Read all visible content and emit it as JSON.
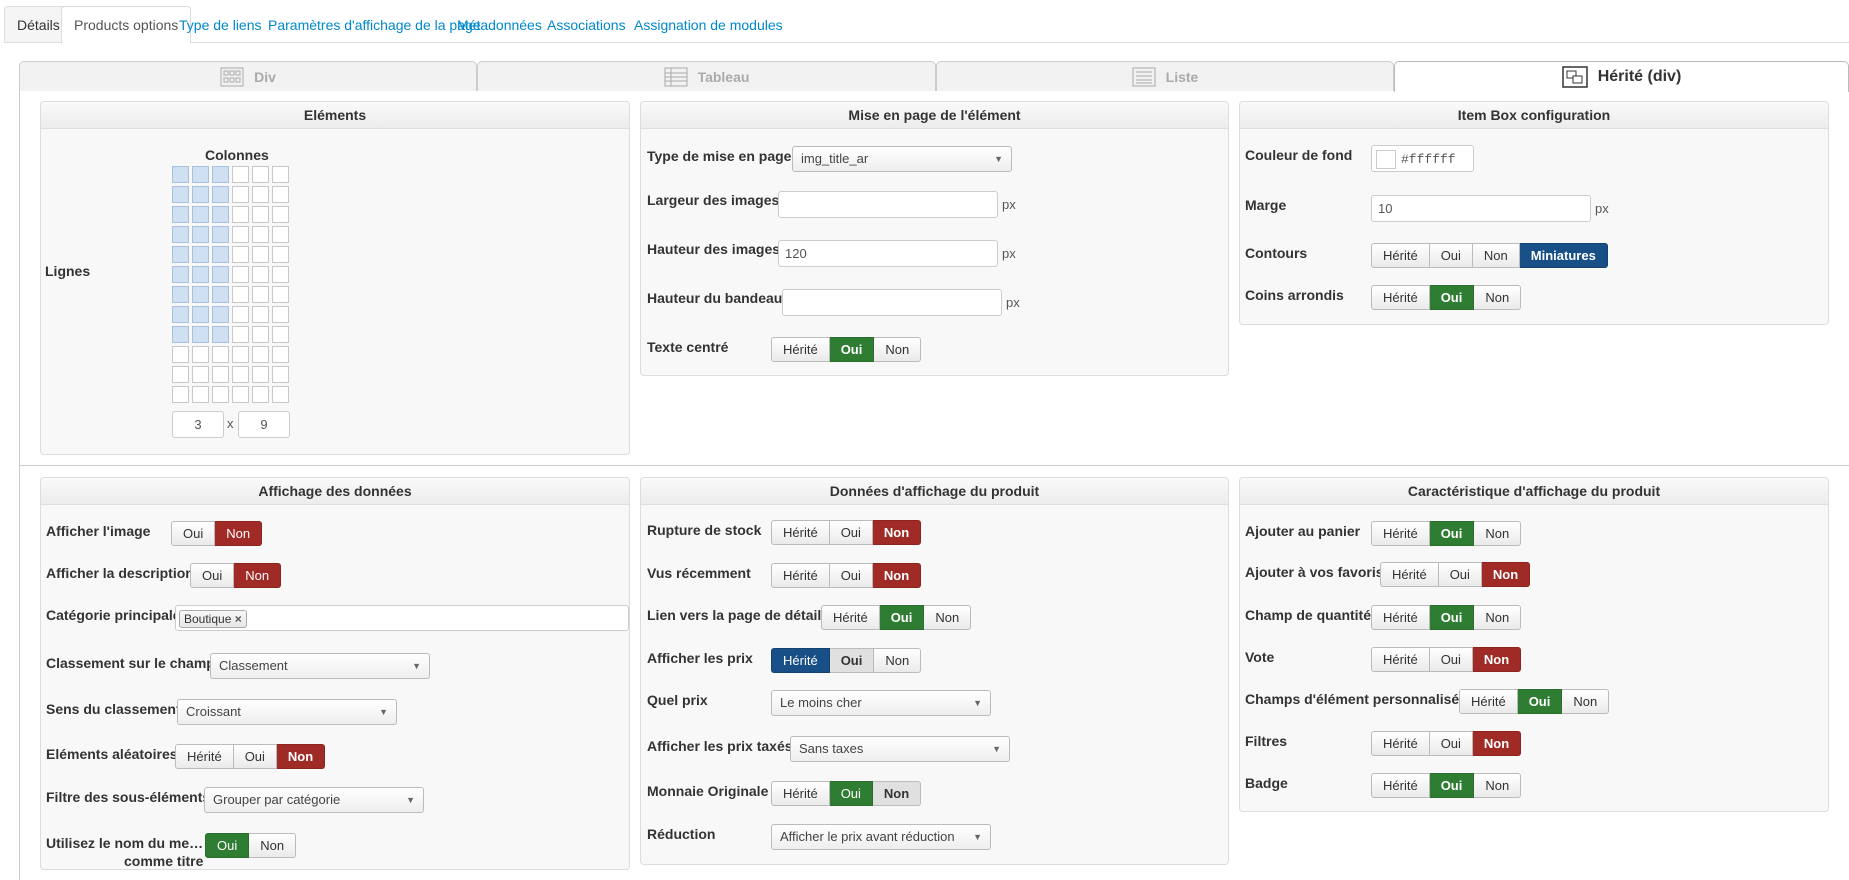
{
  "tabs": [
    "Détails",
    "Products options",
    "Type de liens",
    "Paramètres d'affichage de la page",
    "Métadonnées",
    "Associations",
    "Assignation de modules"
  ],
  "layouts": {
    "div": "Div",
    "tableau": "Tableau",
    "liste": "Liste",
    "herite": "Hérité (div)"
  },
  "elements": {
    "title": "Eléments",
    "colonnes": "Colonnes",
    "lignes": "Lignes",
    "cols": 3,
    "rows": 9,
    "grid_cols": 6,
    "grid_rows": 12,
    "cols_value": "3",
    "x": "x",
    "rows_value": "9"
  },
  "mise": {
    "title": "Mise en page de l'élément",
    "type_label": "Type de mise en page",
    "type_value": "img_title_ar",
    "largeur_label": "Largeur des images",
    "largeur_value": "",
    "hauteur_label": "Hauteur des images",
    "hauteur_value": "120",
    "bandeau_label": "Hauteur du bandeau",
    "bandeau_value": "",
    "centre_label": "Texte centré",
    "px": "px"
  },
  "itembox": {
    "title": "Item Box configuration",
    "couleur_label": "Couleur de fond",
    "couleur_value": "#ffffff",
    "marge_label": "Marge",
    "marge_value": "10",
    "contours_label": "Contours",
    "coins_label": "Coins arrondis"
  },
  "affichage": {
    "title": "Affichage des données",
    "image": "Afficher l'image",
    "description": "Afficher la description",
    "categorie": "Catégorie principale",
    "categorie_tag": "Boutique",
    "classement": "Classement sur le champ",
    "classement_value": "Classement",
    "sens": "Sens du classement",
    "sens_value": "Croissant",
    "aleatoires": "Eléments aléatoires",
    "filtre": "Filtre des sous-éléments",
    "filtre_value": "Grouper par catégorie",
    "nom_l1": "Utilisez le nom du me…",
    "nom_l2": "comme titre"
  },
  "donnees": {
    "title": "Données d'affichage du produit",
    "rupture": "Rupture de stock",
    "vus": "Vus récemment",
    "lien": "Lien vers la page de détail",
    "prix": "Afficher les prix",
    "quel": "Quel prix",
    "quel_value": "Le moins cher",
    "taxes": "Afficher les prix taxés",
    "taxes_value": "Sans taxes",
    "monnaie": "Monnaie Originale",
    "reduction": "Réduction",
    "reduction_value": "Afficher le prix avant réduction"
  },
  "caract": {
    "title": "Caractéristique d'affichage du produit",
    "panier": "Ajouter au panier",
    "favoris": "Ajouter à vos favoris",
    "quantite": "Champ de quantité",
    "vote": "Vote",
    "champs": "Champs d'élément personnalisés",
    "filtres": "Filtres",
    "badge": "Badge"
  },
  "opt": {
    "herite": "Hérité",
    "oui": "Oui",
    "non": "Non",
    "miniatures": "Miniatures"
  }
}
